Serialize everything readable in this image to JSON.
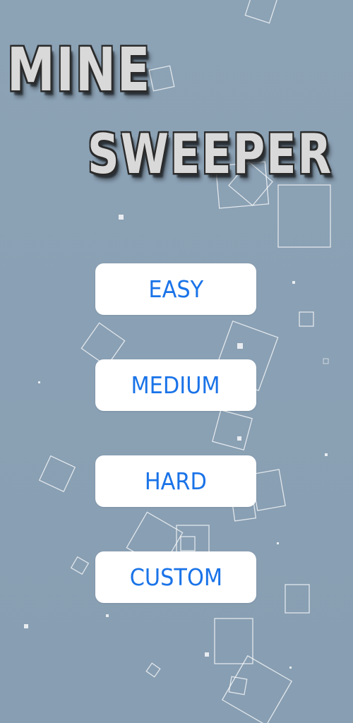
{
  "title": {
    "line1": "MINE",
    "line2": "SWEEPER"
  },
  "menu": {
    "buttons": [
      {
        "label": "EASY"
      },
      {
        "label": "MEDIUM"
      },
      {
        "label": "HARD"
      },
      {
        "label": "CUSTOM"
      }
    ]
  },
  "colors": {
    "background": "#8aa0b4",
    "button_bg": "#ffffff",
    "button_text": "#1a73e8",
    "title_fill": "#e0e0e0",
    "title_outline": "#2a2a2a"
  }
}
